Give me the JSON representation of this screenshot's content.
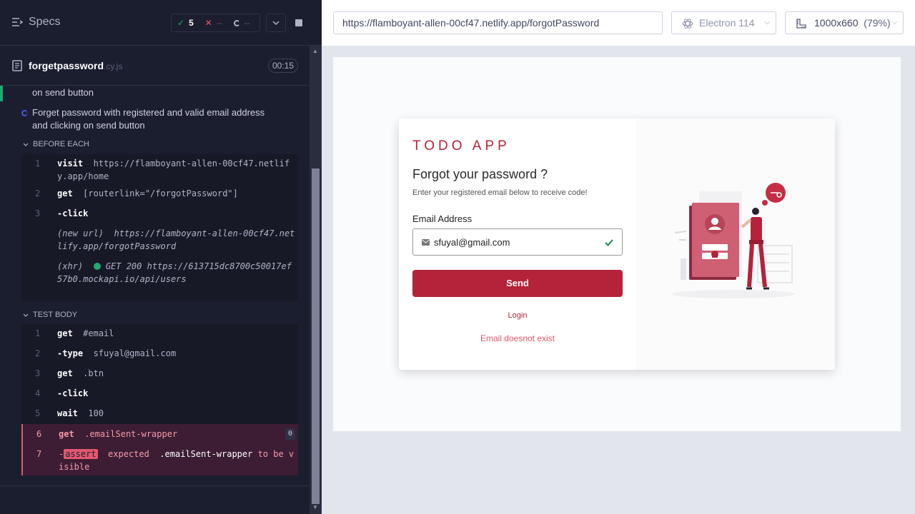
{
  "reporter": {
    "specs_label": "Specs",
    "stats": {
      "passed": "5",
      "failed": "--",
      "pending": "--"
    },
    "spec": {
      "name": "forgetpassword",
      "ext": ".cy.js",
      "duration": "00:15"
    },
    "prev_test_tail": "on send button",
    "current_test": "Forget password with registered and valid email address and clicking on send button",
    "before_each": {
      "title": "BEFORE EACH",
      "commands": [
        {
          "num": "1",
          "name": "visit",
          "message": "https://flamboyant-allen-00cf47.netlify.app/home"
        },
        {
          "num": "2",
          "name": "get",
          "message": "[routerlink=\"/forgotPassword\"]"
        },
        {
          "num": "3",
          "name": "-click",
          "message": ""
        }
      ],
      "new_url_label": "(new url)",
      "new_url": "https://flamboyant-allen-00cf47.netlify.app/forgotPassword",
      "xhr_label": "(xhr)",
      "xhr_status": "GET 200",
      "xhr_url": "https://613715dc8700c50017ef57b0.mockapi.io/api/users"
    },
    "test_body": {
      "title": "TEST BODY",
      "commands": [
        {
          "num": "1",
          "name": "get",
          "message": "#email"
        },
        {
          "num": "2",
          "name": "-type",
          "message": "sfuyal@gmail.com"
        },
        {
          "num": "3",
          "name": "get",
          "message": ".btn"
        },
        {
          "num": "4",
          "name": "-click",
          "message": ""
        },
        {
          "num": "5",
          "name": "wait",
          "message": "100"
        }
      ],
      "failed_get": {
        "num": "6",
        "name": "get",
        "message": ".emailSent-wrapper",
        "count": "0"
      },
      "failed_assert": {
        "num": "7",
        "prefix": "-",
        "badge": "assert",
        "expected": "expected",
        "selector": ".emailSent-wrapper",
        "rest": "to be visible"
      }
    }
  },
  "aut": {
    "url": "https://flamboyant-allen-00cf47.netlify.app/forgotPassword",
    "browser": "Electron 114",
    "viewport": "1000x660",
    "zoom": "(79%)"
  },
  "app": {
    "brand": "TODO APP",
    "heading": "Forgot your password ?",
    "subtext": "Enter your registered email below to receive code!",
    "email_label": "Email Address",
    "email_value": "sfuyal@gmail.com",
    "send_label": "Send",
    "login_label": "Login",
    "error": "Email doesnot exist"
  },
  "colors": {
    "brand": "#b42339",
    "pass": "#1fa971",
    "fail": "#e45770"
  }
}
